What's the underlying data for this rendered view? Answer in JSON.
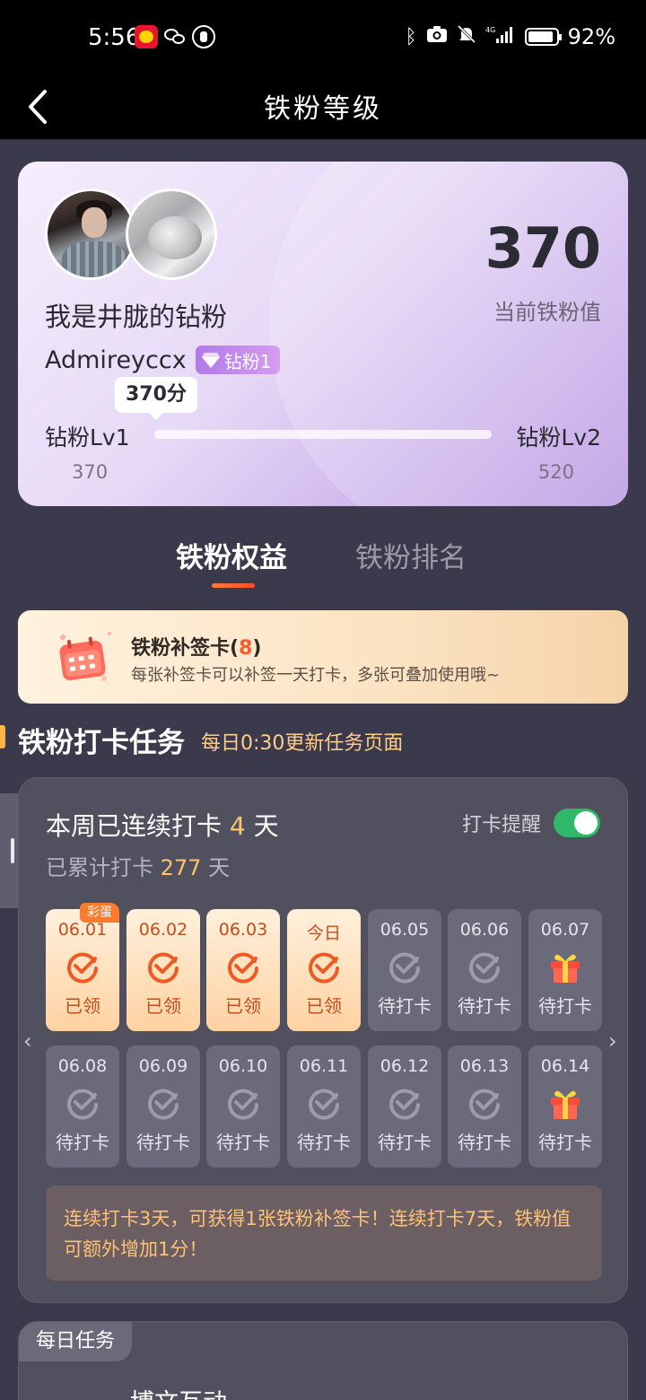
{
  "status_bar": {
    "time": "5:56",
    "battery": "92%",
    "battery_level": 0.92
  },
  "nav": {
    "title": "铁粉等级"
  },
  "profile": {
    "name": "我是井胧的钻粉",
    "username": "Admireyccx",
    "badge": "钻粉1",
    "score": "370",
    "score_label": "当前铁粉值",
    "tooltip": "370分",
    "level_current": "钻粉Lv1",
    "level_next": "钻粉Lv2",
    "range_min": "370",
    "range_max": "520",
    "progress": 0
  },
  "tabs": [
    {
      "label": "铁粉权益",
      "active": true
    },
    {
      "label": "铁粉排名",
      "active": false
    }
  ],
  "makeup_card": {
    "title": "铁粉补签卡(",
    "count": "8",
    "title_end": ")",
    "desc": "每张补签卡可以补签一天打卡，多张可叠加使用哦~"
  },
  "section": {
    "title": "铁粉打卡任务",
    "subtitle": "每日0:30更新任务页面"
  },
  "checkin": {
    "streak_prefix": "本周已连续打卡 ",
    "streak_days": "4",
    "streak_suffix": " 天",
    "total_prefix": "已累计打卡 ",
    "total_days": "277",
    "total_suffix": " 天",
    "reminder_label": "打卡提醒",
    "reminder_on": true,
    "egg_tag": "彩蛋",
    "days": [
      {
        "date": "06.01",
        "status": "已领",
        "state": "done"
      },
      {
        "date": "06.02",
        "status": "已领",
        "state": "done"
      },
      {
        "date": "06.03",
        "status": "已领",
        "state": "done"
      },
      {
        "date": "今日",
        "status": "已领",
        "state": "done"
      },
      {
        "date": "06.05",
        "status": "待打卡",
        "state": "pending"
      },
      {
        "date": "06.06",
        "status": "待打卡",
        "state": "pending"
      },
      {
        "date": "06.07",
        "status": "待打卡",
        "state": "gift"
      },
      {
        "date": "06.08",
        "status": "待打卡",
        "state": "pending"
      },
      {
        "date": "06.09",
        "status": "待打卡",
        "state": "pending"
      },
      {
        "date": "06.10",
        "status": "待打卡",
        "state": "pending"
      },
      {
        "date": "06.11",
        "status": "待打卡",
        "state": "pending"
      },
      {
        "date": "06.12",
        "status": "待打卡",
        "state": "pending"
      },
      {
        "date": "06.13",
        "status": "待打卡",
        "state": "pending"
      },
      {
        "date": "06.14",
        "status": "待打卡",
        "state": "gift"
      }
    ],
    "tip": "连续打卡3天，可获得1张铁粉补签卡！连续打卡7天，铁粉值可额外增加1分！"
  },
  "daily": {
    "tag": "每日任务",
    "first_item": "博文互动"
  },
  "colors": {
    "accent": "#ff5a2e",
    "highlight": "#ffc46b",
    "toggle_on": "#2fb86a",
    "panel": "#50505f"
  }
}
